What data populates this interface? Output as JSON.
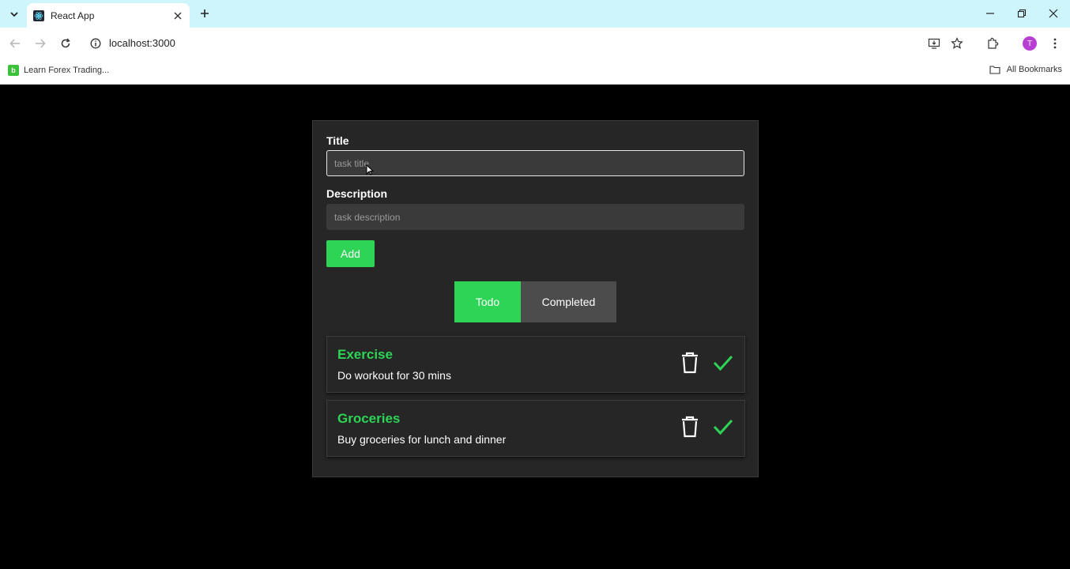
{
  "browser": {
    "tab_title": "React App",
    "url": "localhost:3000",
    "bookmark_label": "Learn Forex Trading...",
    "bookmark_favicon_letter": "b",
    "all_bookmarks_label": "All Bookmarks",
    "profile_initial": "T"
  },
  "form": {
    "title_label": "Title",
    "title_placeholder": "task title",
    "description_label": "Description",
    "description_placeholder": "task description",
    "add_label": "Add"
  },
  "tabs": {
    "todo_label": "Todo",
    "completed_label": "Completed",
    "active": "Todo"
  },
  "tasks": [
    {
      "title": "Exercise",
      "description": "Do workout for 30 mins"
    },
    {
      "title": "Groceries",
      "description": "Buy groceries for lunch and dinner"
    }
  ],
  "colors": {
    "accent": "#2dd455",
    "card_bg": "#262626",
    "input_bg": "#3a3a3a",
    "inactive_tab": "#4c4c4c",
    "page_bg": "#000000"
  }
}
